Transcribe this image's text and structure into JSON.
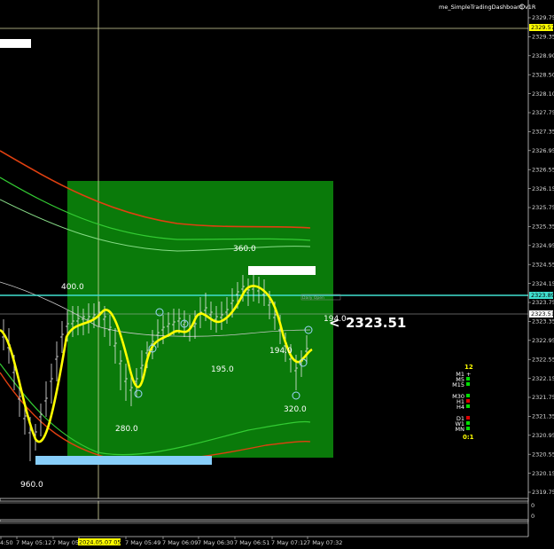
{
  "window": {
    "indicator_title": "me_SimpleTradingDashboard v1R"
  },
  "price_axis": {
    "ticks": [
      "2329.75",
      "2329.35",
      "2328.90",
      "2328.50",
      "2328.10",
      "2327.75",
      "2327.35",
      "2326.95",
      "2326.55",
      "2326.15",
      "2325.75",
      "2325.35",
      "2324.95",
      "2324.55",
      "2324.15",
      "2323.75",
      "2323.35",
      "2322.95",
      "2322.55",
      "2322.15",
      "2321.75",
      "2321.35",
      "2320.95",
      "2320.55",
      "2320.15",
      "2319.75"
    ],
    "tick_prices": [
      2329.75,
      2329.35,
      2328.9,
      2328.5,
      2328.1,
      2327.75,
      2327.35,
      2326.95,
      2326.55,
      2326.15,
      2325.75,
      2325.35,
      2324.95,
      2324.55,
      2324.15,
      2323.75,
      2323.35,
      2322.95,
      2322.55,
      2322.15,
      2321.75,
      2321.35,
      2320.95,
      2320.55,
      2320.15,
      2319.75
    ],
    "tag_top": "2329.57",
    "tag_cyan": "2323.89",
    "tag_current": "2323.51"
  },
  "time_axis": {
    "labels": [
      "4:50",
      "7 May 05:12",
      "7 May 05",
      "2024.05.07 05:35",
      "7 May 05:49",
      "7 May 06:09",
      "7 May 06:30",
      "7 May 06:51",
      "7 May 07:12",
      "7 May 07:32"
    ],
    "cursor_label": "2024.05.07 05:35"
  },
  "annotations": {
    "vol_labels": [
      "400.0",
      "360.0",
      "195.0",
      "194.0",
      "280.0",
      "320.0",
      "960.0",
      "194.0"
    ],
    "big_price": "2323.51",
    "big_arrow": "<",
    "small_tag": "Daily Open"
  },
  "dashboard": {
    "count": "12",
    "timeframes": [
      {
        "label": "M1",
        "state": "+",
        "color": "#ffffff"
      },
      {
        "label": "M5",
        "state": "",
        "color": "#00dd00"
      },
      {
        "label": "M15",
        "state": "",
        "color": "#00dd00"
      },
      {
        "label": "M30",
        "state": "",
        "color": "#00dd00"
      },
      {
        "label": "H1",
        "state": "",
        "color": "#dd0000"
      },
      {
        "label": "H4",
        "state": "",
        "color": "#00dd00"
      },
      {
        "label": "D1",
        "state": "",
        "color": "#dd0000"
      },
      {
        "label": "W1",
        "state": "",
        "color": "#00dd00"
      },
      {
        "label": "MN",
        "state": "",
        "color": "#00dd00"
      }
    ],
    "ratio": "0:1"
  },
  "subwindow": {
    "scale_top": "0",
    "scale_bottom": "0"
  },
  "colors": {
    "background": "#000000",
    "green_zone": "#0a7a0a",
    "yellow_line": "#ffff00",
    "red_band": "#e04010",
    "green_band": "#33cc33",
    "cyan_line": "#40e0d0",
    "light_blue_box": "#87cefa",
    "current_tag": "#ffffff",
    "top_tag": "#ffff00"
  }
}
